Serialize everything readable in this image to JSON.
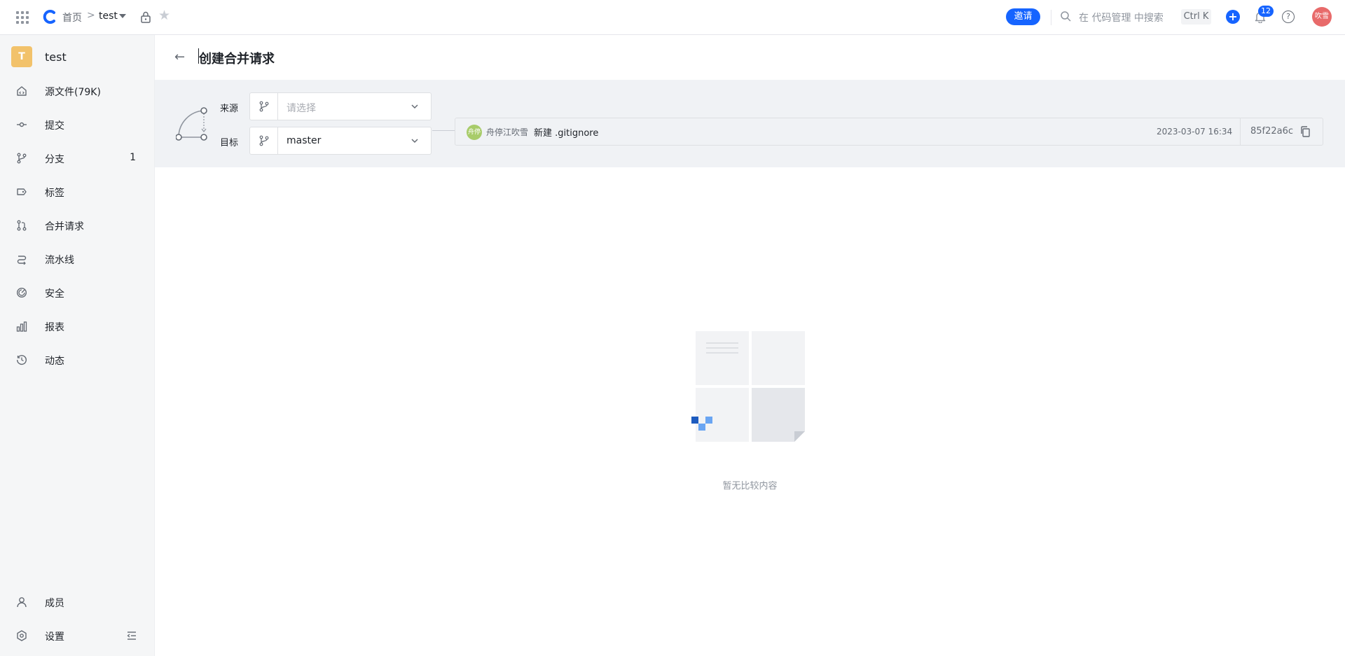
{
  "topbar": {
    "breadcrumb_home": "首页",
    "breadcrumb_sep": ">",
    "repo_name": "test",
    "invite_label": "邀请",
    "search_placeholder": "在 代码管理 中搜索",
    "shortcut": "Ctrl K",
    "notification_count": "12",
    "user_avatar_text": "吹雪",
    "accent_color": "#1664ff"
  },
  "sidebar": {
    "project_initial": "T",
    "project_name": "test",
    "items": [
      {
        "label": "源文件(79K)",
        "icon": "home-code-icon"
      },
      {
        "label": "提交",
        "icon": "commit-icon"
      },
      {
        "label": "分支",
        "icon": "branch-icon",
        "count": "1"
      },
      {
        "label": "标签",
        "icon": "tag-icon"
      },
      {
        "label": "合并请求",
        "icon": "merge-request-icon"
      },
      {
        "label": "流水线",
        "icon": "pipeline-icon"
      },
      {
        "label": "安全",
        "icon": "security-icon"
      },
      {
        "label": "报表",
        "icon": "report-icon"
      },
      {
        "label": "动态",
        "icon": "history-icon"
      }
    ],
    "bottom_items": [
      {
        "label": "成员",
        "icon": "member-icon"
      },
      {
        "label": "设置",
        "icon": "settings-icon"
      }
    ]
  },
  "main": {
    "page_title": "创建合并请求",
    "source_label": "来源",
    "source_placeholder": "请选择",
    "target_label": "目标",
    "target_value": "master",
    "commit": {
      "author_avatar_text": "舟停",
      "author": "舟停江吹雪",
      "message": "新建 .gitignore",
      "time": "2023-03-07 16:34",
      "hash": "85f22a6c"
    },
    "empty_text": "暂无比较内容"
  }
}
